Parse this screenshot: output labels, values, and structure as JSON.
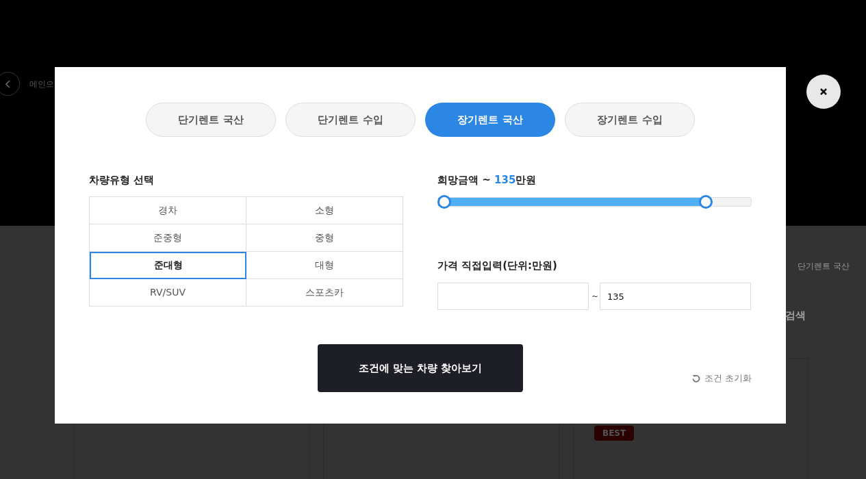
{
  "background": {
    "back_link": "메인으",
    "breadcrumb": "단기렌트 국산",
    "section_title": "검색",
    "badge": "BEST"
  },
  "modal": {
    "tabs": [
      {
        "label": "단기렌트 국산",
        "selected": false
      },
      {
        "label": "단기렌트 수입",
        "selected": false
      },
      {
        "label": "장기렌트 국산",
        "selected": true
      },
      {
        "label": "장기렌트 수입",
        "selected": false
      }
    ],
    "vehicle_type": {
      "title": "차량유형 선택",
      "options": [
        {
          "label": "경차",
          "selected": false
        },
        {
          "label": "소형",
          "selected": false
        },
        {
          "label": "준중형",
          "selected": false
        },
        {
          "label": "중형",
          "selected": false
        },
        {
          "label": "준대형",
          "selected": true
        },
        {
          "label": "대형",
          "selected": false
        },
        {
          "label": "RV/SUV",
          "selected": false
        },
        {
          "label": "스포츠카",
          "selected": false
        }
      ]
    },
    "price": {
      "label": "희망금액 ~ ",
      "amount": "135",
      "unit": "만원",
      "level": 0.87
    },
    "direct_input": {
      "title": "가격 직접입력(단위:만원)",
      "separator": "~",
      "max": "135"
    },
    "search_button": "조건에 맞는 차량 찾아보기",
    "reset": "조건 초기화"
  }
}
